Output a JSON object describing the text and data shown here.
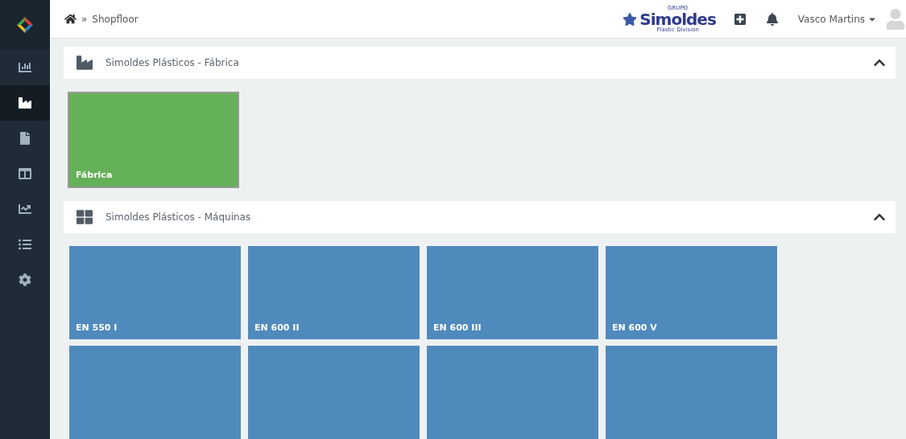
{
  "sidebar": {
    "items": [
      {
        "kind": "chart",
        "selected": false
      },
      {
        "kind": "factory",
        "selected": true
      },
      {
        "kind": "file",
        "selected": false
      },
      {
        "kind": "columns",
        "selected": false
      },
      {
        "kind": "trend",
        "selected": false
      },
      {
        "kind": "list",
        "selected": false
      },
      {
        "kind": "settings",
        "selected": false
      }
    ]
  },
  "breadcrumb": {
    "separator": "»",
    "current": "Shopfloor"
  },
  "header": {
    "logo": {
      "top": "GRUPO",
      "name": "Simoldes",
      "sub": "Plastic Division"
    },
    "user": "Vasco Martins"
  },
  "sections": [
    {
      "kind": "factory",
      "title": "Simoldes Plásticos - Fábrica",
      "expanded": true,
      "tiles": [
        {
          "label": "Fábrica",
          "color": "#64b058"
        }
      ]
    },
    {
      "kind": "machines",
      "title": "Simoldes Plásticos - Máquinas",
      "expanded": true,
      "tiles": [
        {
          "label": "EN 550 I",
          "color": "#4f8abd"
        },
        {
          "label": "EN 600 II",
          "color": "#4f8abd"
        },
        {
          "label": "EN 600 III",
          "color": "#4f8abd"
        },
        {
          "label": "EN 600 V",
          "color": "#4f8abd"
        },
        {
          "color": "#4f8abd"
        },
        {
          "color": "#4f8abd"
        },
        {
          "color": "#4f8abd"
        },
        {
          "color": "#4f8abd"
        }
      ]
    }
  ]
}
